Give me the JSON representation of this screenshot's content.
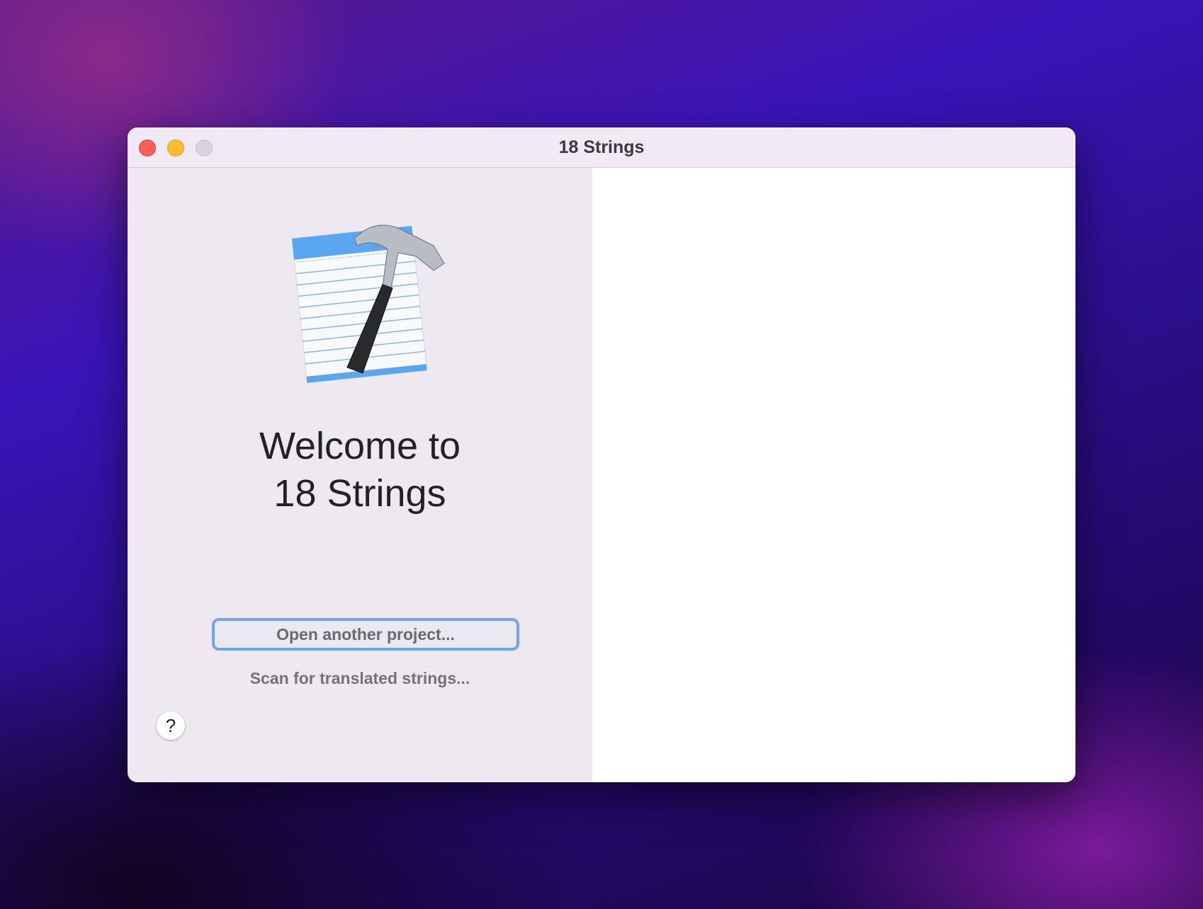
{
  "window": {
    "title": "18 Strings"
  },
  "welcome": {
    "line1": "Welcome to",
    "line2": "18 Strings"
  },
  "actions": {
    "open_project": "Open another project...",
    "scan_strings": "Scan for translated strings..."
  },
  "help": {
    "label": "?"
  },
  "colors": {
    "accent": "#74a3ec",
    "close": "#fe5f57",
    "minimize": "#febc2e"
  }
}
